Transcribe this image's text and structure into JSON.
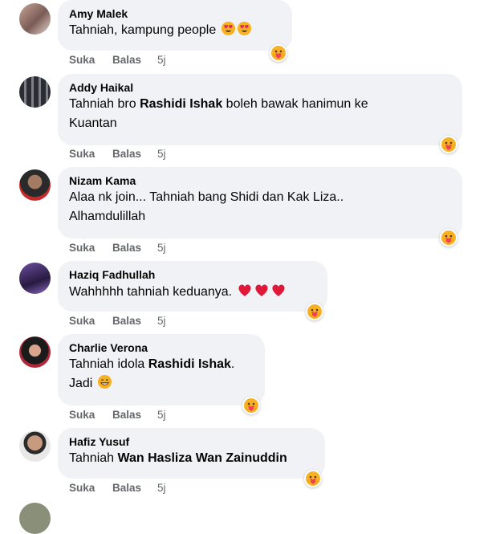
{
  "actions": {
    "like": "Suka",
    "reply": "Balas",
    "time": "5j"
  },
  "comments": [
    {
      "name": "Amy Malek",
      "parts": [
        "Tahniah, kampung people"
      ]
    },
    {
      "name": "Addy Haikal",
      "parts": [
        "Tahniah bro ",
        "Rashidi Ishak",
        " boleh bawak hanimun ke",
        "Kuantan"
      ]
    },
    {
      "name": "Nizam Kama",
      "parts": [
        "Alaa nk join... Tahniah bang Shidi dan Kak Liza..",
        "Alhamdulillah"
      ]
    },
    {
      "name": "Haziq Fadhullah",
      "parts": [
        "Wahhhhh tahniah keduanya."
      ]
    },
    {
      "name": "Charlie Verona",
      "parts": [
        "Tahniah idola ",
        "Rashidi Ishak",
        ".",
        "Jadi"
      ]
    },
    {
      "name": "Hafiz Yusuf",
      "parts": [
        "Tahniah ",
        "Wan Hasliza Wan Zainuddin"
      ]
    }
  ]
}
